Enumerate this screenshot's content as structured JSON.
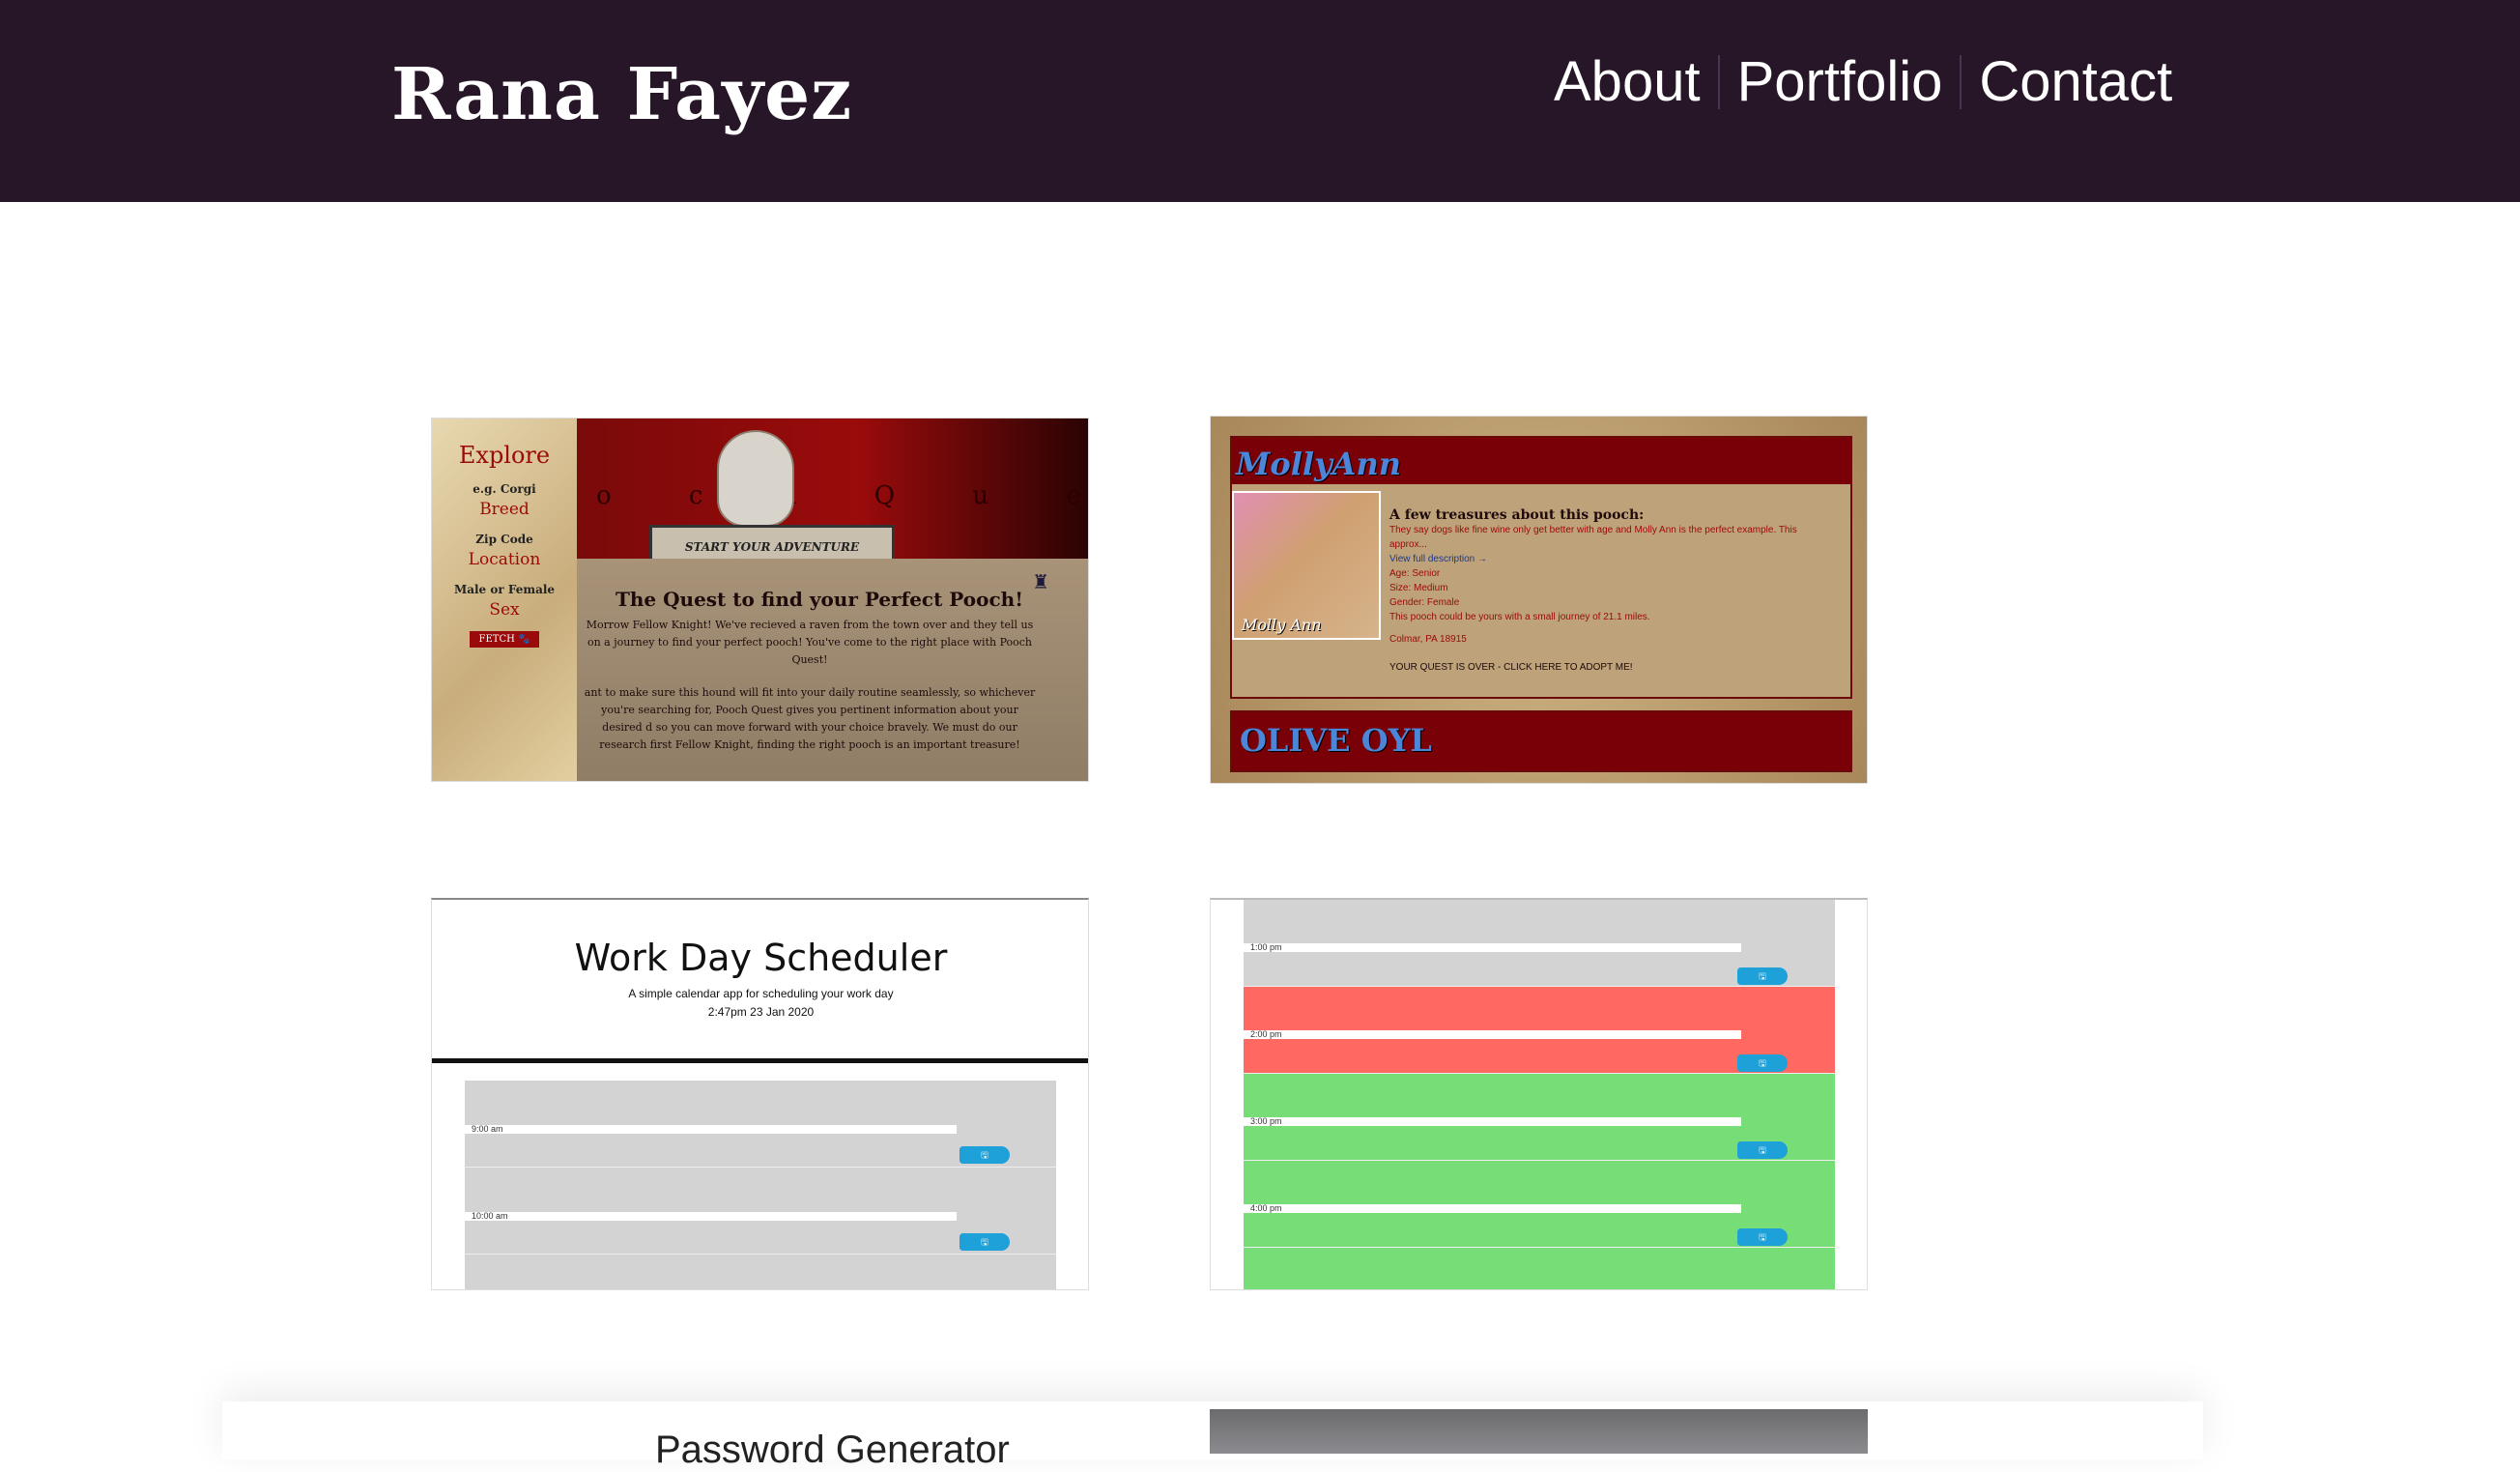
{
  "header": {
    "brand": "Rana Fayez",
    "nav": [
      "About",
      "Portfolio",
      "Contact"
    ]
  },
  "colors": {
    "header_bg": "#271627",
    "hour_past": "#d3d3d3",
    "hour_present": "#ff6961",
    "hour_future": "#77dd77",
    "save_button": "#1ea0d8"
  },
  "projects": {
    "pooch_quest": {
      "sidebar": {
        "explore": "Explore",
        "breed_hint": "e.g. Corgi",
        "breed": "Breed",
        "zip_hint": "Zip Code",
        "location": "Location",
        "sex_hint": "Male or Female",
        "sex": "Sex",
        "fetch": "FETCH 🐾"
      },
      "banner_letters": "o c h Q u e s t",
      "start": "START YOUR ADVENTURE",
      "quest_title": "The Quest to find your Perfect Pooch!",
      "para1": "Morrow Fellow Knight! We've recieved a raven from the town over and they tell us on a journey to find your perfect pooch! You've come to the right place with Pooch Quest!",
      "para2": "ant to make sure this hound will fit into your daily routine seamlessly, so whichever you're searching for, Pooch Quest gives you pertinent information about your desired d so you can move forward with your choice bravely. We must do our research first Fellow Knight, finding the right pooch is an important treasure!"
    },
    "molly_ann": {
      "name": "MollyAnn",
      "photo_caption": "Molly Ann",
      "heading": "A few treasures about this pooch:",
      "desc": "They say dogs like fine wine only get better with age and Molly Ann is the perfect example. This approx...",
      "more": "View full description →",
      "age": "Age: Senior",
      "size": "Size: Medium",
      "gender": "Gender: Female",
      "journey": "This pooch could be yours with a small journey of 21.1 miles.",
      "location": "Colmar, PA 18915",
      "cta": "YOUR QUEST IS OVER - CLICK HERE TO ADOPT ME!",
      "next_name": "OLIVE OYL"
    },
    "scheduler": {
      "title": "Work Day Scheduler",
      "subtitle": "A simple calendar app for scheduling your work day",
      "datetime": "2:47pm 23 Jan 2020",
      "left_rows": [
        {
          "time": "9:00 am",
          "status": "past"
        },
        {
          "time": "10:00 am",
          "status": "past"
        }
      ],
      "right_rows": [
        {
          "time": "1:00 pm",
          "status": "past"
        },
        {
          "time": "2:00 pm",
          "status": "present"
        },
        {
          "time": "3:00 pm",
          "status": "future"
        },
        {
          "time": "4:00 pm",
          "status": "future"
        }
      ],
      "save_icon": "🖫"
    },
    "password": {
      "title": "Password Generator"
    }
  }
}
